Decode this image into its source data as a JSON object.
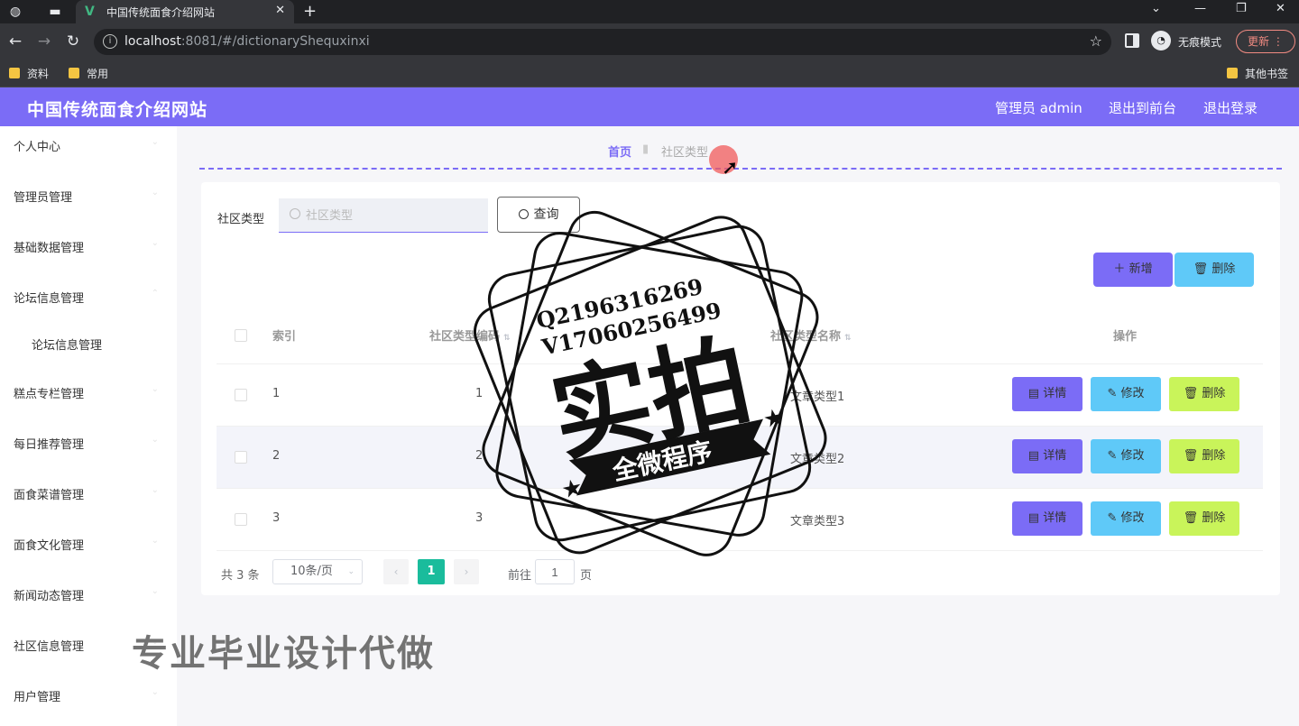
{
  "browser": {
    "tab_title": "中国传统面食介绍网站",
    "url_host": "localhost",
    "url_rest": ":8081/#/dictionaryShequxinxi",
    "incognito_label": "无痕模式",
    "update_label": "更新",
    "bookmarks": [
      "资料",
      "常用"
    ],
    "other_bookmarks": "其他书签"
  },
  "header": {
    "brand": "中国传统面食介绍网站",
    "admin": "管理员 admin",
    "to_front": "退出到前台",
    "logout": "退出登录"
  },
  "sidebar": {
    "items": [
      {
        "label": "个人中心"
      },
      {
        "label": "管理员管理"
      },
      {
        "label": "基础数据管理"
      },
      {
        "label": "论坛信息管理"
      },
      {
        "label": "论坛信息管理"
      },
      {
        "label": "糕点专栏管理"
      },
      {
        "label": "每日推荐管理"
      },
      {
        "label": "面食菜谱管理"
      },
      {
        "label": "面食文化管理"
      },
      {
        "label": "新闻动态管理"
      },
      {
        "label": "社区信息管理"
      },
      {
        "label": "用户管理"
      }
    ]
  },
  "breadcrumb": {
    "home": "首页",
    "current": "社区类型"
  },
  "search": {
    "label": "社区类型",
    "placeholder": "社区类型",
    "query_button": "查询"
  },
  "actions": {
    "add": "新增",
    "delete": "删除"
  },
  "table": {
    "headers": {
      "index": "索引",
      "code": "社区类型编码",
      "name": "社区类型名称",
      "ops": "操作"
    },
    "rows": [
      {
        "index": "1",
        "code": "1",
        "name": "文章类型1"
      },
      {
        "index": "2",
        "code": "2",
        "name": "文章类型2"
      },
      {
        "index": "3",
        "code": "3",
        "name": "文章类型3"
      }
    ],
    "row_actions": {
      "detail": "详情",
      "edit": "修改",
      "delete": "删除"
    }
  },
  "pager": {
    "total": "共 3 条",
    "page_size": "10条/页",
    "current": "1",
    "goto_label": "前往",
    "goto_value": "1",
    "unit": "页"
  },
  "watermark": {
    "contact1": "Q2196316269",
    "contact2": "V17060256499",
    "big": "实拍",
    "banner": "全微程序",
    "bottom": "专业毕业设计代做"
  },
  "colors": {
    "accent": "#7b6cf6",
    "info": "#5fc9f8",
    "warn": "#c9f45a",
    "page_active": "#1abc9c"
  }
}
